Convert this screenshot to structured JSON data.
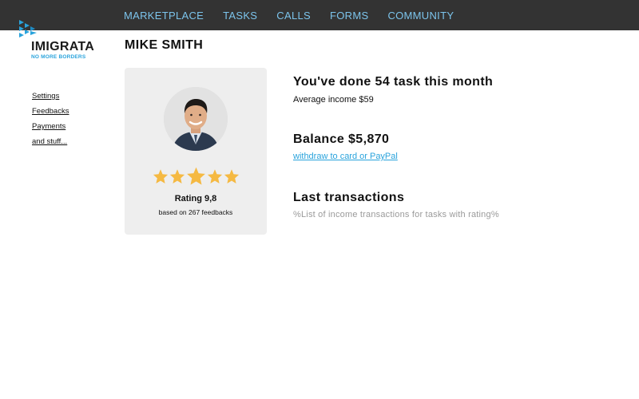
{
  "brand": {
    "name": "IMIGRATA",
    "tagline": "NO MORE BORDERS",
    "logo_icon": "chevrons-logo-icon",
    "colors": {
      "accent": "#29a3dc",
      "nav_text": "#7cc4ec",
      "topbar": "#333333"
    }
  },
  "nav": {
    "items": [
      {
        "label": "MARKETPLACE"
      },
      {
        "label": "TASKS"
      },
      {
        "label": "CALLS"
      },
      {
        "label": "FORMS"
      },
      {
        "label": "COMMUNITY"
      }
    ]
  },
  "sidebar": {
    "items": [
      {
        "label": "Settings"
      },
      {
        "label": "Feedbacks"
      },
      {
        "label": "Payments"
      },
      {
        "label": "and stuff..."
      }
    ]
  },
  "profile": {
    "name": "MIKE SMITH",
    "rating_label": "Rating 9,8",
    "feedbacks_label": "based on 267 feedbacks",
    "stars": {
      "filled": 5,
      "total": 5,
      "color": "#f5b942"
    }
  },
  "stats": {
    "tasks_heading": "You've done 54 task this month",
    "income_label": "Average income $59",
    "balance_heading": "Balance $5,870",
    "withdraw_link": "withdraw to card or PayPal",
    "transactions_heading": "Last transactions",
    "transactions_placeholder": "%List of income transactions for tasks with rating%"
  }
}
